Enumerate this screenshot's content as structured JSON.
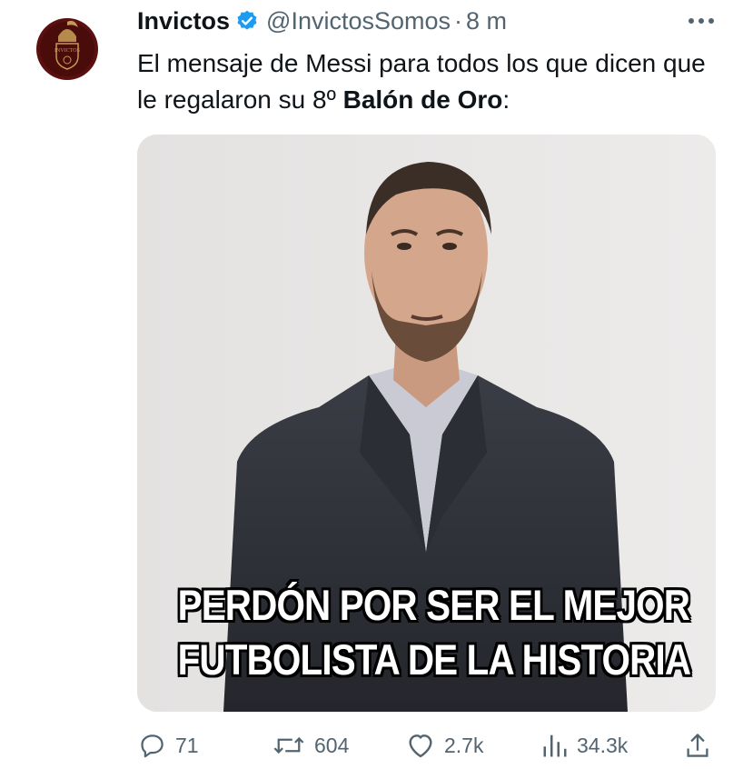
{
  "tweet": {
    "display_name": "Invictos",
    "handle": "@InvictosSomos",
    "separator": "·",
    "time": "8 m",
    "text_part1": "El mensaje de Messi para todos los que dicen que le regalaron su 8º ",
    "text_bold": "Balón de Oro",
    "text_part2": ":",
    "avatar_icon": "invictos-logo",
    "avatar_logo_text": "INVICTOS"
  },
  "media": {
    "caption_line1": "PERDÓN POR SER EL MEJOR",
    "caption_line2": "FUTBOLISTA DE LA HISTORIA"
  },
  "actions": {
    "replies": "71",
    "retweets": "604",
    "likes": "2.7k",
    "views": "34.3k"
  },
  "colors": {
    "text": "#0f1419",
    "secondary": "#536471",
    "verified": "#1d9bf0",
    "avatar_bg": "#5a1010"
  }
}
